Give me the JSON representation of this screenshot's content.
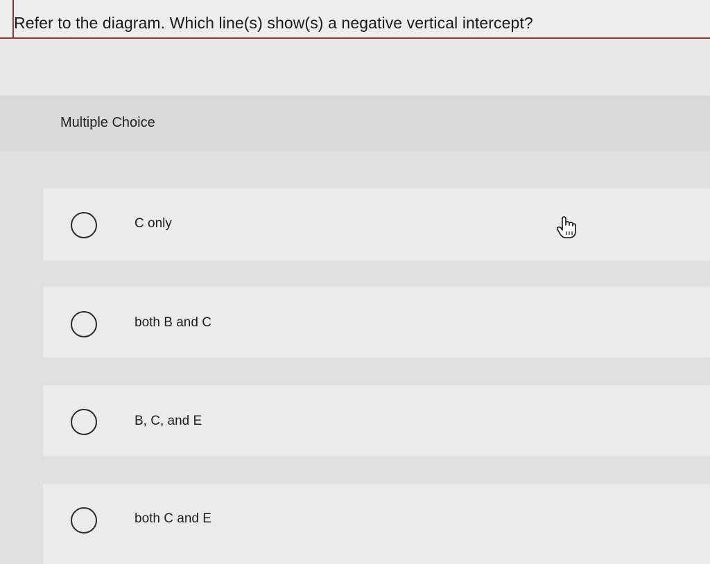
{
  "question": {
    "text": "Refer to the diagram. Which line(s) show(s) a negative vertical intercept?"
  },
  "section": {
    "label": "Multiple Choice"
  },
  "options": [
    {
      "label": "C only"
    },
    {
      "label": "both B and C"
    },
    {
      "label": "B, C, and E"
    },
    {
      "label": "both C and E"
    }
  ],
  "cursor": {
    "icon": "hand-pointer-icon"
  },
  "colors": {
    "accent_border": "#8a3a34",
    "radio_stroke": "#2a2a2a"
  }
}
